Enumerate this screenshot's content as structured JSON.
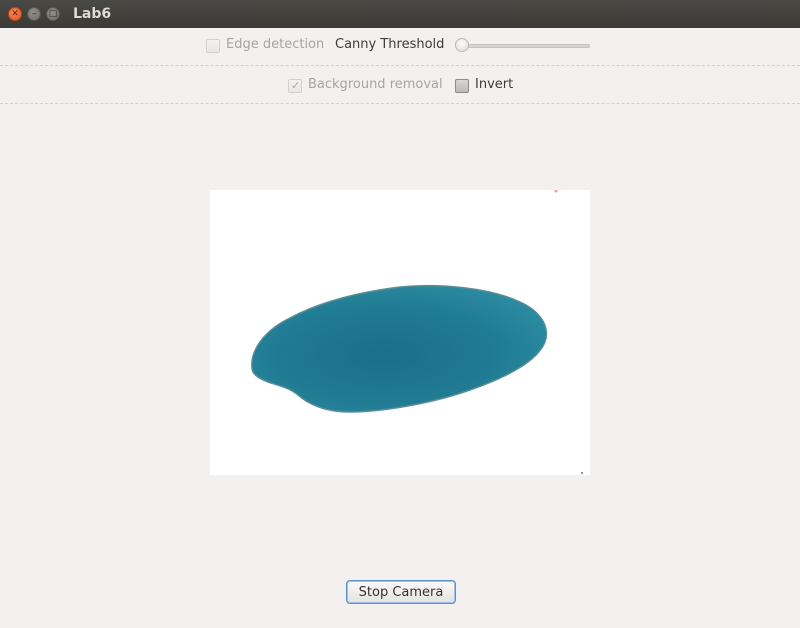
{
  "window": {
    "title": "Lab6"
  },
  "controls": {
    "edge_detection": {
      "label": "Edge detection",
      "checked": false,
      "enabled": false
    },
    "canny_threshold": {
      "label": "Canny Threshold",
      "value": 0
    },
    "background_removal": {
      "label": "Background removal",
      "checked": true,
      "enabled": false
    },
    "invert": {
      "label": "Invert",
      "checked": false,
      "enabled": true
    }
  },
  "actions": {
    "stop_camera": "Stop Camera"
  },
  "colors": {
    "titlebar": "#3c3b37",
    "background": "#f2f1f0",
    "blob_fill": "#1e7891",
    "focus_border": "#5f8fc6"
  }
}
